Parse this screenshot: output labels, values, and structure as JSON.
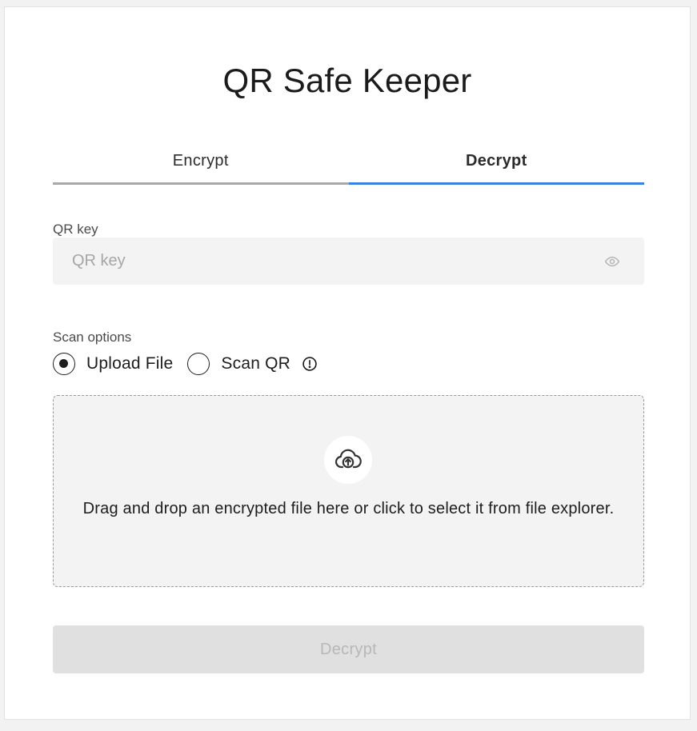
{
  "app": {
    "title": "QR Safe Keeper"
  },
  "tabs": [
    {
      "label": "Encrypt",
      "active": false
    },
    {
      "label": "Decrypt",
      "active": true
    }
  ],
  "key_field": {
    "label": "QR key",
    "placeholder": "QR key",
    "value": "",
    "icon": "eye-icon"
  },
  "scan": {
    "label": "Scan options",
    "options": [
      {
        "label": "Upload File",
        "selected": true
      },
      {
        "label": "Scan QR",
        "selected": false
      }
    ],
    "info_icon": "info-icon"
  },
  "dropzone": {
    "icon": "cloud-upload-icon",
    "text": "Drag and drop an encrypted file here or click to select it from file explorer."
  },
  "submit": {
    "label": "Decrypt",
    "disabled": true
  },
  "colors": {
    "accent": "#3b82e0",
    "inactive_tab_border": "#a8a8a8",
    "field_bg": "#f3f3f3",
    "disabled_button_bg": "#e0e0e0",
    "disabled_button_text": "#b7b7b7"
  }
}
